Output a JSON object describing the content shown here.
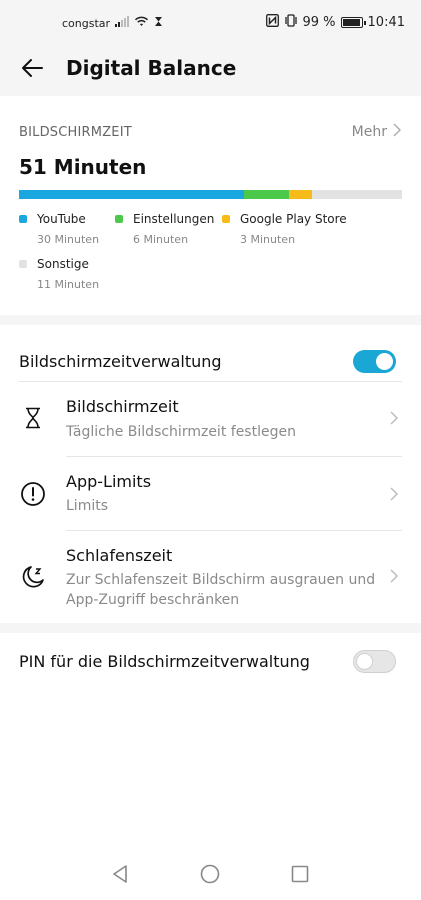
{
  "status_bar": {
    "carrier": "congstar",
    "battery_text": "99 %",
    "battery_level": 0.99,
    "time": "10:41"
  },
  "header": {
    "title": "Digital Balance",
    "back_icon": "arrow-left-icon"
  },
  "screen_time": {
    "section_label": "BILDSCHIRMZEIT",
    "more_label": "Mehr",
    "total": "51 Minuten",
    "bar": [
      {
        "name": "YouTube",
        "minutes": 30,
        "color": "#1aa7e0"
      },
      {
        "name": "Einstellungen",
        "minutes": 6,
        "color": "#4cc94a"
      },
      {
        "name": "Google Play Store",
        "minutes": 3,
        "color": "#f6bb18"
      }
    ],
    "bar_total_minutes": 51,
    "bar_background": "#e2e2e2",
    "legend": [
      {
        "name": "YouTube",
        "value": "30 Minuten",
        "color": "#1aa7e0"
      },
      {
        "name": "Einstellungen",
        "value": "6 Minuten",
        "color": "#4cc94a"
      },
      {
        "name": "Google Play Store",
        "value": "3 Minuten",
        "color": "#f6bb18"
      },
      {
        "name": "Sonstige",
        "value": "11 Minuten",
        "color": "#e2e2e2"
      }
    ]
  },
  "management": {
    "toggle_label": "Bildschirmzeitverwaltung",
    "toggle_on": true,
    "accent": "#1aa7d6",
    "items": [
      {
        "title": "Bildschirmzeit",
        "subtitle": "Tägliche Bildschirmzeit festlegen",
        "icon": "hourglass-icon"
      },
      {
        "title": "App-Limits",
        "subtitle": "Limits",
        "icon": "exclamation-circle-icon"
      },
      {
        "title": "Schlafenszeit",
        "subtitle": "Zur Schlafenszeit Bildschirm ausgrauen und App-Zugriff beschränken",
        "icon": "moon-sleep-icon"
      }
    ]
  },
  "pin": {
    "label": "PIN für die Bildschirmzeitverwaltung",
    "toggle_on": false
  },
  "nav": {
    "back_icon": "triangle-back-icon",
    "home_icon": "circle-home-icon",
    "recents_icon": "square-recents-icon"
  }
}
